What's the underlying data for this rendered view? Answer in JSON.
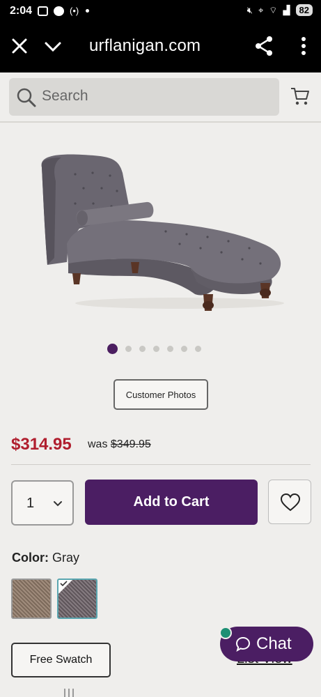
{
  "status_bar": {
    "time": "2:04",
    "battery": "82",
    "network": "6E"
  },
  "browser": {
    "url": "urflanigan.com"
  },
  "search": {
    "placeholder": "Search"
  },
  "gallery": {
    "total_images": 7,
    "active_index": 0,
    "customer_photos_label": "Customer Photos"
  },
  "pricing": {
    "price": "$314.95",
    "was_label": "was",
    "was_price": "$349.95"
  },
  "purchase": {
    "quantity": "1",
    "add_to_cart_label": "Add to Cart"
  },
  "color": {
    "label": "Color:",
    "value": "Gray",
    "swatches": [
      "Tan",
      "Gray"
    ],
    "selected": "Gray"
  },
  "actions": {
    "free_swatch_label": "Free Swatch",
    "list_view_label": "List View"
  },
  "chat": {
    "label": "Chat"
  },
  "colors": {
    "brand_purple": "#4b1e63",
    "price_red": "#b01e2e",
    "background": "#efeeec"
  }
}
